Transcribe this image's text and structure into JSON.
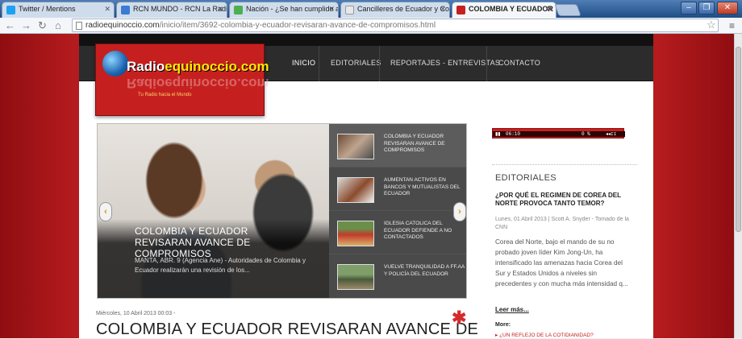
{
  "browser": {
    "tabs": [
      {
        "label": "Twitter / Mentions",
        "color": "#1da1f2"
      },
      {
        "label": "RCN MUNDO - RCN La Radio",
        "color": "#3a7bd5"
      },
      {
        "label": "Nación - ¿Se han cumplido ac",
        "color": "#4caf50"
      },
      {
        "label": "Cancilleres de Ecuador y Col",
        "color": "#e8e8e8"
      },
      {
        "label": "COLOMBIA Y ECUADOR REV",
        "color": "#c5201f"
      }
    ],
    "url_domain": "radioequinoccio.com",
    "url_path": "/inicio/item/3692-colombia-y-ecuador-revisaran-avance-de-compromisos.html"
  },
  "site": {
    "logo_text_a": "Radio",
    "logo_text_b": "equinoccio.com",
    "slogan": "Tu Radio hacia el Mundo",
    "nav": [
      "INICIO",
      "EDITORIALES",
      "REPORTAJES - ENTREVISTAS",
      "CONTACTO"
    ]
  },
  "slider": {
    "title": "COLOMBIA Y ECUADOR REVISARAN AVANCE DE COMPROMISOS",
    "text": "MANTA, ABR. 9 (Agencia Ane) - Autoridades de Colombia y Ecuador realizarán una revisión de los...",
    "prev": "‹",
    "next": "›",
    "items": [
      "COLOMBIA Y ECUADOR REVISARAN AVANCE DE COMPROMISOS",
      "AUMENTAN ACTIVOS EN BANCOS Y MUTUALISTAS DEL ECUADOR",
      "IGLESIA CATOLICA DEL ECUADOR DEFIENDE A NO CONTACTADOS",
      "VUELVE TRANQUILIDAD A FF.AA Y POLICÍA DEL ECUADOR"
    ]
  },
  "article": {
    "date": "Miércoles, 10 Abril 2013 00:03 -",
    "title": "COLOMBIA Y ECUADOR REVISARAN AVANCE DE"
  },
  "player": {
    "time": "06:10",
    "volume": "0 %",
    "vol_icon": "◂◂ɪɪ"
  },
  "sidebar": {
    "heading": "EDITORIALES",
    "title": "¿POR QUÉ EL REGIMEN DE COREA DEL NORTE PROVOCA TANTO TEMOR?",
    "meta": "Lunes, 01 Abril 2013 | Scott A. Snyder - Tomado de la CNN",
    "text": "Corea del Norte, bajo el mando de su no probado joven líder Kim Jong-Un, ha intensificado las amenazas hacia Corea del Sur y Estados Unidos a niveles sin precedentes y con mucha más intensidad q...",
    "more": "Leer más...",
    "more_heading": "More:",
    "more_link": "¿UN REFLEJO DE LA COTIDIANIDAD?"
  }
}
